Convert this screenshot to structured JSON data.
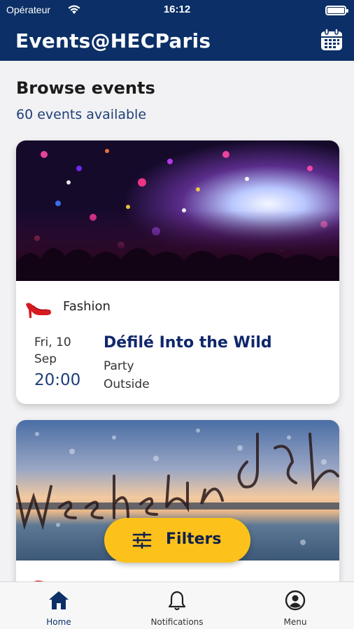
{
  "status_bar": {
    "carrier": "Opérateur",
    "time": "16:12"
  },
  "header": {
    "title": "Events@HECParis",
    "calendar_icon": "calendar-icon"
  },
  "page": {
    "heading": "Browse events",
    "events_count": "60 events available"
  },
  "events": [
    {
      "image": "confetti-concert-crowd",
      "category": "Fashion",
      "category_icon": "high-heel-icon",
      "date_day": "Fri, 10",
      "date_month": "Sep",
      "time": "20:00",
      "title": "Défilé Into the Wild",
      "type": "Party",
      "location": "Outside"
    },
    {
      "image": "rainy-window-weekend"
    }
  ],
  "filters": {
    "label": "Filters",
    "icon": "sliders-icon"
  },
  "tab_bar": {
    "tabs": [
      {
        "label": "Home",
        "icon": "home-icon",
        "active": true
      },
      {
        "label": "Notifications",
        "icon": "bell-icon",
        "active": false
      },
      {
        "label": "Menu",
        "icon": "user-circle-icon",
        "active": false
      }
    ]
  },
  "colors": {
    "primary": "#0b2f66",
    "accent": "#fcc21b",
    "title_text": "#10276b",
    "background": "#f2f2f4"
  }
}
